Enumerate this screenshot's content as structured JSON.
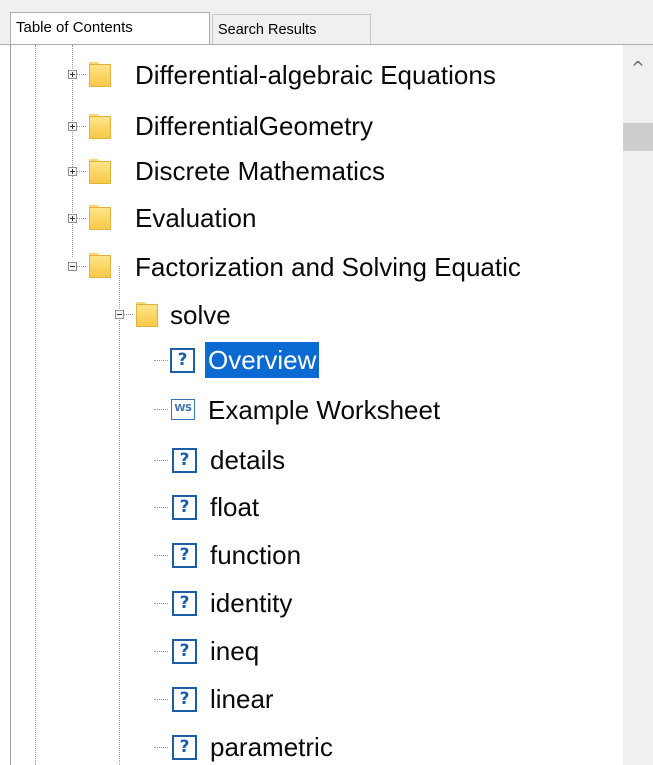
{
  "tabs": {
    "table_of_contents": "Table of Contents",
    "search_results": "Search Results"
  },
  "tree": {
    "differential_algebraic": "Differential-algebraic Equations",
    "differential_geometry": "DifferentialGeometry",
    "discrete_math": "Discrete Mathematics",
    "evaluation": "Evaluation",
    "factorization": "Factorization and Solving Equatic",
    "solve": "solve",
    "overview": "Overview",
    "example_worksheet": "Example Worksheet",
    "details": "details",
    "float": "float",
    "function": "function",
    "identity": "identity",
    "ineq": "ineq",
    "linear": "linear",
    "parametric": "parametric"
  },
  "icons": {
    "help_glyph": "?",
    "worksheet_glyph": "WS",
    "scroll_up_glyph": "^"
  },
  "colors": {
    "selection": "#0a6ad1",
    "help_icon": "#1a5ea8",
    "folder": "#f6c948"
  }
}
